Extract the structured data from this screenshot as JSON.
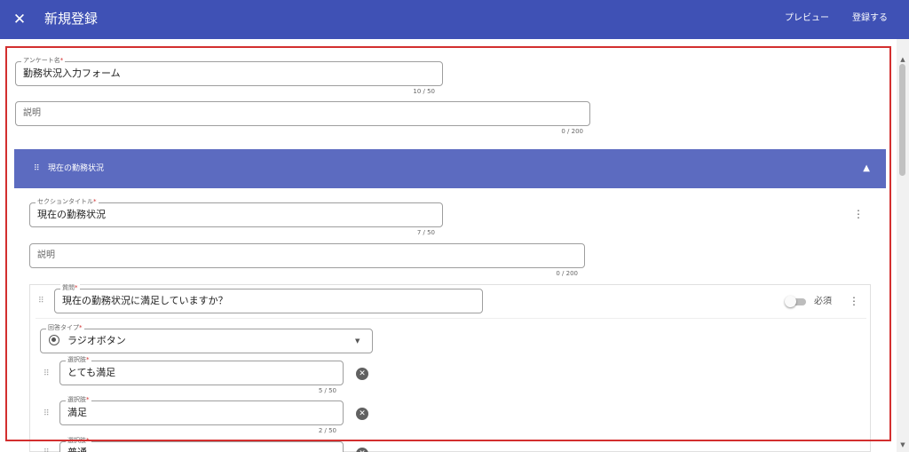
{
  "header": {
    "close_icon": "close-icon",
    "title": "新規登録",
    "preview_label": "プレビュー",
    "register_label": "登録する",
    "color": "#3f51b5"
  },
  "survey": {
    "name_label": "アンケート名",
    "name_value": "勤務状況入力フォーム",
    "name_counter": "10 / 50",
    "description_placeholder": "説明",
    "description_counter": "0 / 200"
  },
  "section": {
    "header_title": "現在の勤務状況",
    "header_color": "#5c6bc0",
    "collapse_icon": "chevron-up-icon",
    "title_label": "セクションタイトル",
    "title_value": "現在の勤務状況",
    "title_counter": "7 / 50",
    "description_placeholder": "説明",
    "description_counter": "0 / 200"
  },
  "question": {
    "label": "質問",
    "value": "現在の勤務状況に満足していますか？",
    "required_label": "必須",
    "required_on": false,
    "answer_type_label": "回答タイプ",
    "answer_type_value": "ラジオボタン",
    "answer_type_icon": "radio-button-icon",
    "choices": [
      {
        "label": "選択肢",
        "value": "とても満足",
        "counter": "5 / 50"
      },
      {
        "label": "選択肢",
        "value": "満足",
        "counter": "2 / 50"
      },
      {
        "label": "選択肢",
        "value": "普通",
        "counter": ""
      }
    ]
  },
  "required_mark": "*",
  "highlight_color": "#d32f2f"
}
